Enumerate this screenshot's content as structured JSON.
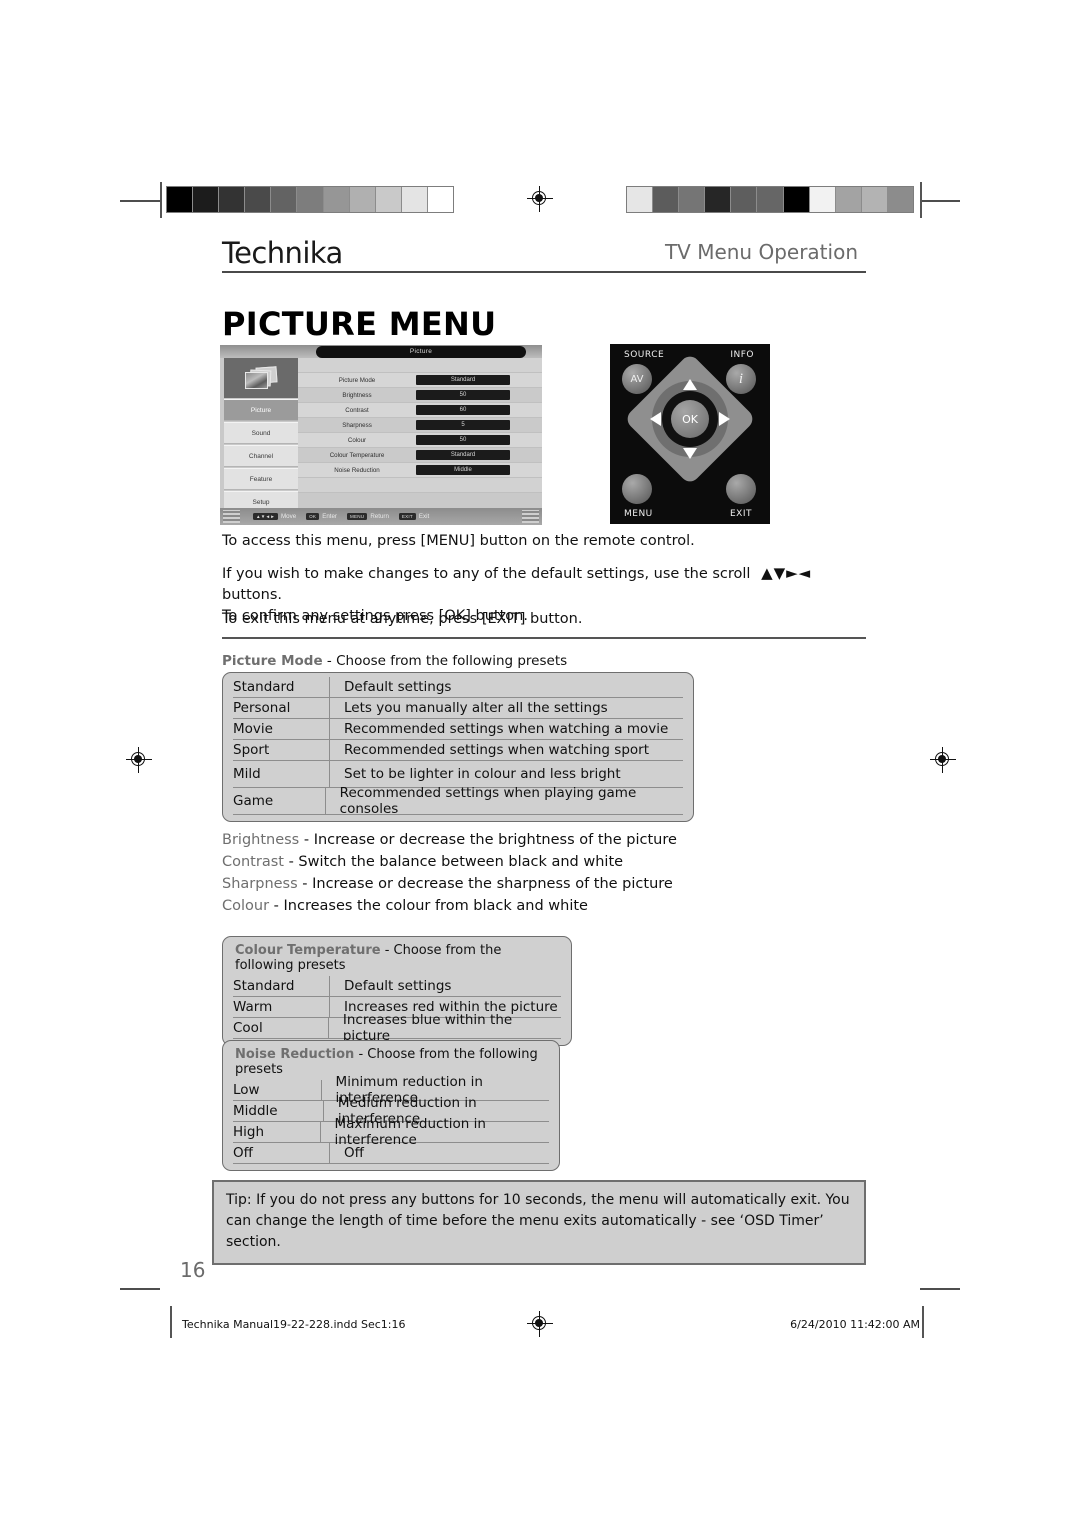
{
  "header": {
    "brand": "Technika",
    "section": "TV Menu Operation",
    "page_title": "PICTURE MENU"
  },
  "osd": {
    "title": "Picture",
    "nav": [
      {
        "label": "Picture",
        "active": true
      },
      {
        "label": "Sound",
        "active": false
      },
      {
        "label": "Channel",
        "active": false
      },
      {
        "label": "Feature",
        "active": false
      },
      {
        "label": "Setup",
        "active": false
      }
    ],
    "rows": [
      {
        "label": "Picture Mode",
        "value": "Standard"
      },
      {
        "label": "Brightness",
        "value": "50"
      },
      {
        "label": "Contrast",
        "value": "60"
      },
      {
        "label": "Sharpness",
        "value": "5"
      },
      {
        "label": "Colour",
        "value": "50"
      },
      {
        "label": "Colour Temperature",
        "value": "Standard"
      },
      {
        "label": "Noise Reduction",
        "value": "Middle"
      }
    ],
    "hints": [
      {
        "key": "▲▼◄►",
        "text": "Move"
      },
      {
        "key": "OK",
        "text": "Enter"
      },
      {
        "key": "MENU",
        "text": "Return"
      },
      {
        "key": "EXIT",
        "text": "Exit"
      }
    ]
  },
  "remote": {
    "source_label": "SOURCE",
    "info_label": "INFO",
    "menu_label": "MENU",
    "exit_label": "EXIT",
    "av_button": "AV",
    "info_button": "i",
    "ok_button": "OK"
  },
  "intro": {
    "para1": "To access this menu, press [MENU] button on the remote control.",
    "para2_before": "If you wish to make changes to any of the default settings, use the scroll",
    "para2_arrows": "▲▼►◄",
    "para2_after": "buttons.",
    "para2_line2": "To confirm any settings press [OK] button.",
    "para3": "To exit this menu at anytime, press [EXIT] button."
  },
  "picture_mode_table": {
    "caption_key": "Picture Mode",
    "caption_rest": " - Choose from the following presets",
    "rows": [
      {
        "name": "Standard",
        "desc": "Default settings"
      },
      {
        "name": "Personal",
        "desc": "Lets you manually alter all the settings"
      },
      {
        "name": "Movie",
        "desc": "Recommended settings when watching a movie"
      },
      {
        "name": "Sport",
        "desc": "Recommended settings when watching sport"
      },
      {
        "name": "Mild",
        "desc": "Set to be lighter in colour and less bright"
      },
      {
        "name": "Game",
        "desc": "Recommended settings when playing game consoles"
      }
    ]
  },
  "definitions": [
    {
      "key": "Brightness",
      "rest": " - Increase or decrease the brightness of the picture"
    },
    {
      "key": "Contrast",
      "rest": " - Switch the balance between black and white"
    },
    {
      "key": "Sharpness",
      "rest": " - Increase or decrease the sharpness of the picture"
    },
    {
      "key": "Colour",
      "rest": " - Increases the colour from black and white"
    }
  ],
  "colour_temperature_table": {
    "caption_key": "Colour Temperature",
    "caption_rest": " - Choose from the following presets",
    "rows": [
      {
        "name": "Standard",
        "desc": "Default settings"
      },
      {
        "name": "Warm",
        "desc": "Increases red within the picture"
      },
      {
        "name": "Cool",
        "desc": "Increases blue within the picture"
      }
    ]
  },
  "noise_reduction_table": {
    "caption_key": "Noise Reduction",
    "caption_rest": " - Choose from the following presets",
    "rows": [
      {
        "name": "Low",
        "desc": "Minimum reduction in interference"
      },
      {
        "name": "Middle",
        "desc": "Medium reduction in interference"
      },
      {
        "name": "High",
        "desc": "Maximum reduction in interference"
      },
      {
        "name": "Off",
        "desc": "Off"
      }
    ]
  },
  "tip": {
    "text": "Tip: If you do not press any buttons for 10 seconds, the menu will automatically exit. You can change the length of time before the menu exits automatically - see ‘OSD Timer’ section."
  },
  "footer": {
    "page_number": "16",
    "file_info": "Technika Manual19-22-228.indd   Sec1:16",
    "timestamp": "6/24/2010   11:42:00 AM"
  },
  "swatches": {
    "left": [
      "#000000",
      "#1c1c1c",
      "#333333",
      "#4a4a4a",
      "#636363",
      "#7d7d7d",
      "#969696",
      "#b0b0b0",
      "#c9c9c9",
      "#e4e4e4",
      "#ffffff"
    ],
    "right": [
      "#e6e6e6",
      "#5c5c5c",
      "#757575",
      "#262626",
      "#5e5e5e",
      "#666666",
      "#000000",
      "#f2f2f2",
      "#a3a3a3",
      "#b3b3b3",
      "#8c8c8c"
    ]
  }
}
